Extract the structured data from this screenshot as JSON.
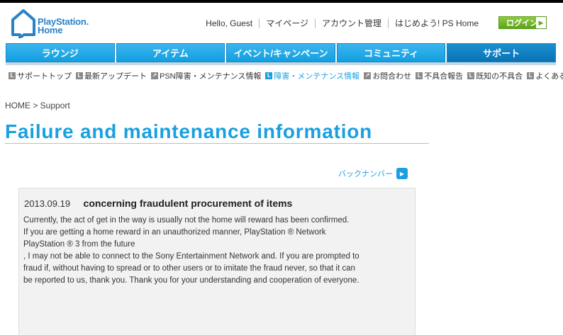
{
  "header": {
    "logo_line1": "PlayStation.",
    "logo_line2": "Home",
    "links": [
      "Hello, Guest",
      "マイページ",
      "アカウント管理",
      "はじめよう! PS Home"
    ],
    "login_label": "ログイン"
  },
  "nav": {
    "tabs": [
      "ラウンジ",
      "アイテム",
      "イベント/キャンペーン",
      "コミュニティ",
      "サポート"
    ],
    "active_tab": "サポート"
  },
  "subnav": {
    "items": [
      "サポートトップ",
      "最新アップデート",
      "PSN障害・メンテナンス情報",
      "障害・メンテナンス情報",
      "お問合わせ",
      "不具合報告",
      "既知の不具合",
      "よくある質問"
    ],
    "selected": "障害・メンテナンス情報"
  },
  "breadcrumb": "HOME  >  Support",
  "page_title": "Failure and maintenance information",
  "back_number_label": "バックナンバー",
  "article": {
    "date": "2013.09.19",
    "title": "concerning fraudulent procurement of items",
    "body_lines": [
      "Currently, the act of get in the way is usually not the home will reward has been confirmed.",
      "If you are getting a home reward in an unauthorized manner, PlayStation ® Network",
      "PlayStation ® 3 from the future",
      ", I may not be able to connect to the Sony Entertainment Network and. If you are prompted to",
      "fraud if, without having to spread or to other users or to imitate the fraud never, so that it can",
      "be reported to us, thank you. Thank you for your understanding and cooperation of everyone."
    ]
  },
  "colors": {
    "accent_blue": "#1aa0e0",
    "login_green": "#6ab22a",
    "nav_active": "#0a72b4"
  }
}
